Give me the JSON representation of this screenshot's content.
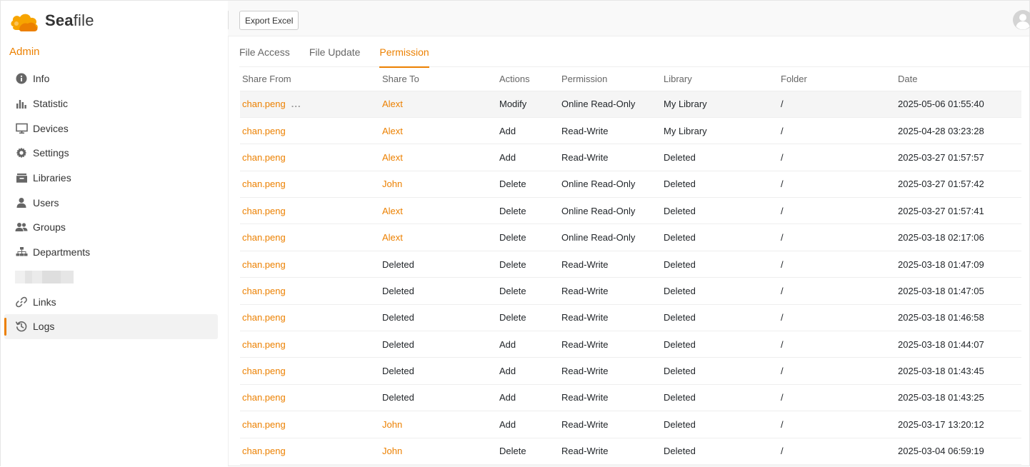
{
  "brand": {
    "name_prefix": "Sea",
    "name_suffix": "file"
  },
  "sidebar": {
    "section_title": "Admin",
    "items": [
      {
        "label": "Info",
        "icon": "info-icon"
      },
      {
        "label": "Statistic",
        "icon": "bar-chart-icon"
      },
      {
        "label": "Devices",
        "icon": "monitor-icon"
      },
      {
        "label": "Settings",
        "icon": "gear-icon"
      },
      {
        "label": "Libraries",
        "icon": "library-icon"
      },
      {
        "label": "Users",
        "icon": "user-icon"
      },
      {
        "label": "Groups",
        "icon": "group-icon"
      },
      {
        "label": "Departments",
        "icon": "org-chart-icon"
      },
      {
        "label": "",
        "icon": ""
      },
      {
        "label": "Links",
        "icon": "link-icon"
      },
      {
        "label": "Logs",
        "icon": "history-icon"
      }
    ],
    "active": "Logs"
  },
  "toolbar": {
    "export_label": "Export Excel"
  },
  "tabs": [
    {
      "label": "File Access"
    },
    {
      "label": "File Update"
    },
    {
      "label": "Permission"
    }
  ],
  "table": {
    "headers": [
      "Share From",
      "Share To",
      "Actions",
      "Permission",
      "Library",
      "Folder",
      "Date"
    ],
    "rows": [
      [
        "chan.peng",
        "Alext",
        "Modify",
        "Online Read-Only",
        "My Library",
        "/",
        "2025-05-06 01:55:40"
      ],
      [
        "chan.peng",
        "Alext",
        "Add",
        "Read-Write",
        "My Library",
        "/",
        "2025-04-28 03:23:28"
      ],
      [
        "chan.peng",
        "Alext",
        "Add",
        "Read-Write",
        "Deleted",
        "/",
        "2025-03-27 01:57:57"
      ],
      [
        "chan.peng",
        "John",
        "Delete",
        "Online Read-Only",
        "Deleted",
        "/",
        "2025-03-27 01:57:42"
      ],
      [
        "chan.peng",
        "Alext",
        "Delete",
        "Online Read-Only",
        "Deleted",
        "/",
        "2025-03-27 01:57:41"
      ],
      [
        "chan.peng",
        "Alext",
        "Delete",
        "Online Read-Only",
        "Deleted",
        "/",
        "2025-03-18 02:17:06"
      ],
      [
        "chan.peng",
        "Deleted",
        "Delete",
        "Read-Write",
        "Deleted",
        "/",
        "2025-03-18 01:47:09"
      ],
      [
        "chan.peng",
        "Deleted",
        "Delete",
        "Read-Write",
        "Deleted",
        "/",
        "2025-03-18 01:47:05"
      ],
      [
        "chan.peng",
        "Deleted",
        "Delete",
        "Read-Write",
        "Deleted",
        "/",
        "2025-03-18 01:46:58"
      ],
      [
        "chan.peng",
        "Deleted",
        "Add",
        "Read-Write",
        "Deleted",
        "/",
        "2025-03-18 01:44:07"
      ],
      [
        "chan.peng",
        "Deleted",
        "Add",
        "Read-Write",
        "Deleted",
        "/",
        "2025-03-18 01:43:45"
      ],
      [
        "chan.peng",
        "Deleted",
        "Add",
        "Read-Write",
        "Deleted",
        "/",
        "2025-03-18 01:43:25"
      ],
      [
        "chan.peng",
        "John",
        "Add",
        "Read-Write",
        "Deleted",
        "/",
        "2025-03-17 13:20:12"
      ],
      [
        "chan.peng",
        "John",
        "Delete",
        "Read-Write",
        "Deleted",
        "/",
        "2025-03-04 06:59:19"
      ]
    ],
    "row_more_label": "..."
  },
  "colors": {
    "accent": "#ec8000"
  }
}
